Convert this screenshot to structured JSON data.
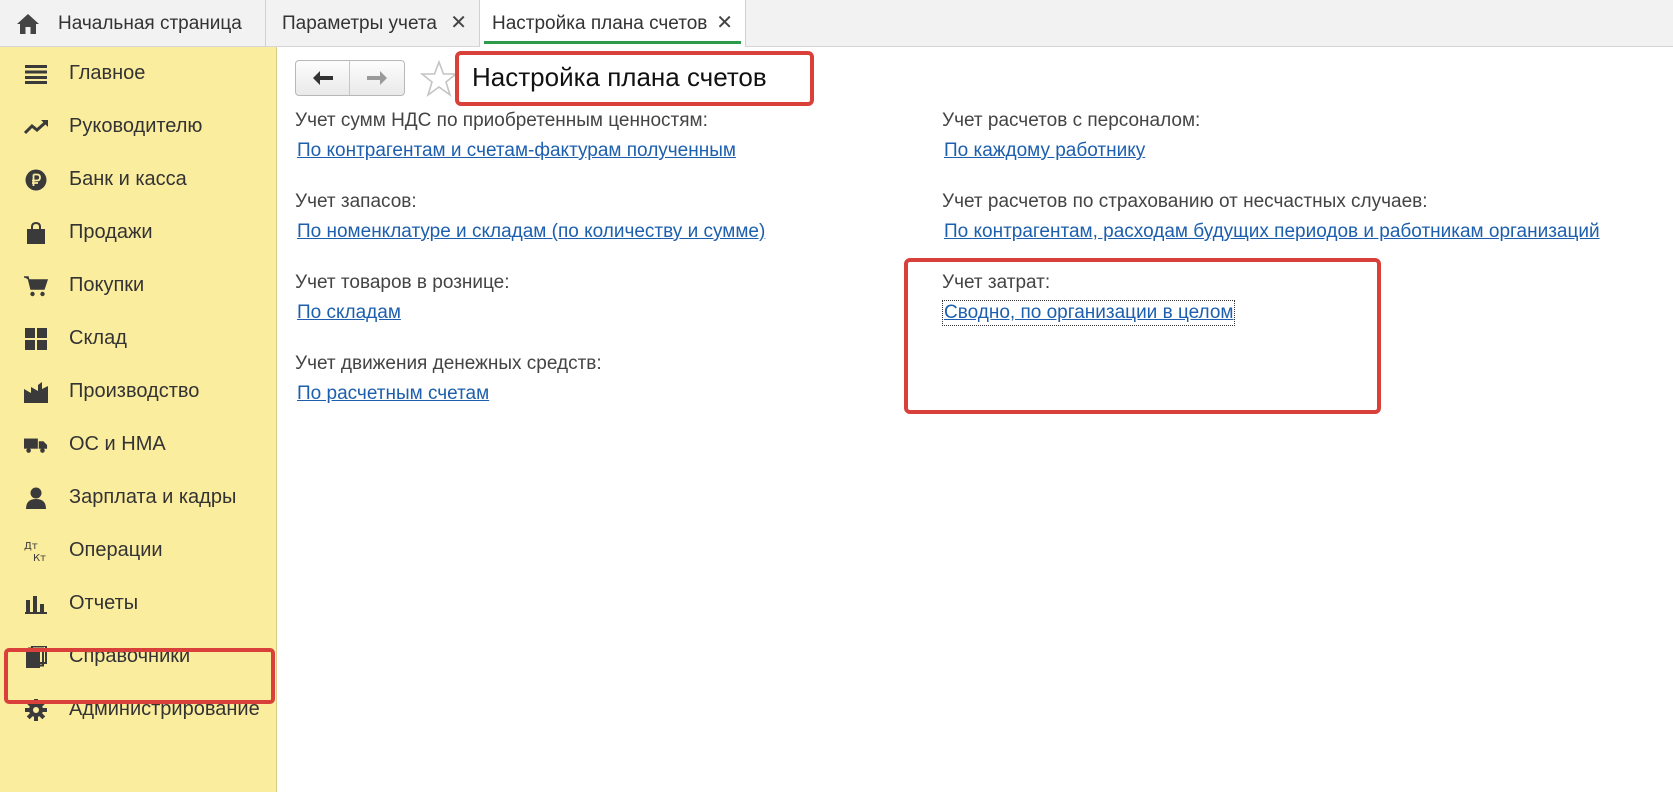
{
  "tabs": {
    "home_label": "Начальная страница",
    "params_label": "Параметры учета",
    "active_label": "Настройка плана счетов",
    "close_glyph": "✕"
  },
  "sidebar": {
    "items": [
      {
        "label": "Главное",
        "icon": "menu-lines-icon"
      },
      {
        "label": "Руководителю",
        "icon": "trend-up-icon"
      },
      {
        "label": "Банк и касса",
        "icon": "ruble-coin-icon"
      },
      {
        "label": "Продажи",
        "icon": "shopping-bag-icon"
      },
      {
        "label": "Покупки",
        "icon": "shopping-cart-icon"
      },
      {
        "label": "Склад",
        "icon": "warehouse-grid-icon"
      },
      {
        "label": "Производство",
        "icon": "factory-icon"
      },
      {
        "label": "ОС и НМА",
        "icon": "truck-icon"
      },
      {
        "label": "Зарплата и кадры",
        "icon": "person-icon"
      },
      {
        "label": "Операции",
        "icon": "debit-credit-icon"
      },
      {
        "label": "Отчеты",
        "icon": "bar-chart-icon"
      },
      {
        "label": "Справочники",
        "icon": "books-icon"
      },
      {
        "label": "Администрирование",
        "icon": "gear-icon"
      }
    ]
  },
  "toolbar": {
    "back_glyph": "🡐",
    "forward_glyph": "🡒"
  },
  "page": {
    "title": "Настройка плана счетов"
  },
  "settings": {
    "vat_label": "Учет сумм НДС по приобретенным ценностям:",
    "vat_value": "По контрагентам и счетам-фактурам полученным",
    "stock_label": "Учет запасов:",
    "stock_value": "По номенклатуре и складам (по количеству и сумме)",
    "retail_label": "Учет товаров в рознице:",
    "retail_value": "По складам",
    "cash_label": "Учет движения денежных средств:",
    "cash_value": "По расчетным счетам",
    "staff_label": "Учет расчетов с персоналом:",
    "staff_value": "По каждому работнику",
    "insurance_label": "Учет расчетов по страхованию от несчастных случаев:",
    "insurance_value": "По контрагентам, расходам будущих периодов и работникам организаций",
    "costs_label": "Учет затрат:",
    "costs_value": "Сводно, по организации в целом"
  },
  "colors": {
    "sidebar_bg": "#fbed9e",
    "link": "#1d5fae",
    "highlight_frame": "#d9403a",
    "active_tab_underline": "#2e9b4b"
  }
}
